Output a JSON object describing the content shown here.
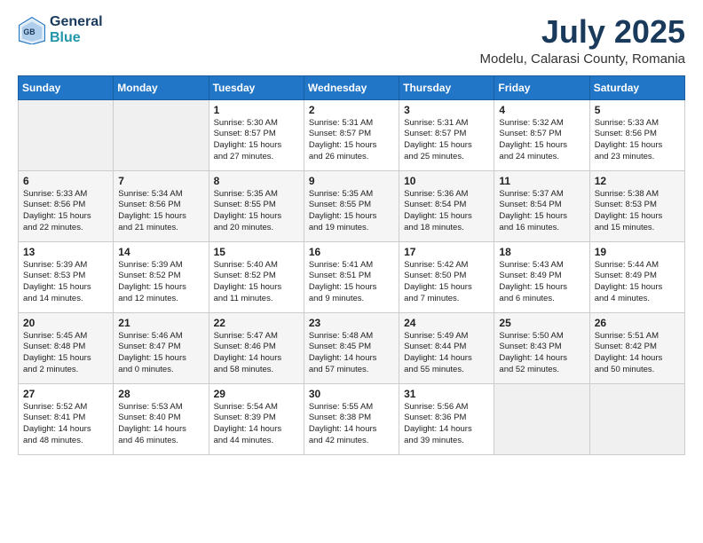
{
  "header": {
    "logo_line1": "General",
    "logo_line2": "Blue",
    "month": "July 2025",
    "location": "Modelu, Calarasi County, Romania"
  },
  "days_of_week": [
    "Sunday",
    "Monday",
    "Tuesday",
    "Wednesday",
    "Thursday",
    "Friday",
    "Saturday"
  ],
  "weeks": [
    [
      {
        "day": "",
        "info": ""
      },
      {
        "day": "",
        "info": ""
      },
      {
        "day": "1",
        "info": "Sunrise: 5:30 AM\nSunset: 8:57 PM\nDaylight: 15 hours\nand 27 minutes."
      },
      {
        "day": "2",
        "info": "Sunrise: 5:31 AM\nSunset: 8:57 PM\nDaylight: 15 hours\nand 26 minutes."
      },
      {
        "day": "3",
        "info": "Sunrise: 5:31 AM\nSunset: 8:57 PM\nDaylight: 15 hours\nand 25 minutes."
      },
      {
        "day": "4",
        "info": "Sunrise: 5:32 AM\nSunset: 8:57 PM\nDaylight: 15 hours\nand 24 minutes."
      },
      {
        "day": "5",
        "info": "Sunrise: 5:33 AM\nSunset: 8:56 PM\nDaylight: 15 hours\nand 23 minutes."
      }
    ],
    [
      {
        "day": "6",
        "info": "Sunrise: 5:33 AM\nSunset: 8:56 PM\nDaylight: 15 hours\nand 22 minutes."
      },
      {
        "day": "7",
        "info": "Sunrise: 5:34 AM\nSunset: 8:56 PM\nDaylight: 15 hours\nand 21 minutes."
      },
      {
        "day": "8",
        "info": "Sunrise: 5:35 AM\nSunset: 8:55 PM\nDaylight: 15 hours\nand 20 minutes."
      },
      {
        "day": "9",
        "info": "Sunrise: 5:35 AM\nSunset: 8:55 PM\nDaylight: 15 hours\nand 19 minutes."
      },
      {
        "day": "10",
        "info": "Sunrise: 5:36 AM\nSunset: 8:54 PM\nDaylight: 15 hours\nand 18 minutes."
      },
      {
        "day": "11",
        "info": "Sunrise: 5:37 AM\nSunset: 8:54 PM\nDaylight: 15 hours\nand 16 minutes."
      },
      {
        "day": "12",
        "info": "Sunrise: 5:38 AM\nSunset: 8:53 PM\nDaylight: 15 hours\nand 15 minutes."
      }
    ],
    [
      {
        "day": "13",
        "info": "Sunrise: 5:39 AM\nSunset: 8:53 PM\nDaylight: 15 hours\nand 14 minutes."
      },
      {
        "day": "14",
        "info": "Sunrise: 5:39 AM\nSunset: 8:52 PM\nDaylight: 15 hours\nand 12 minutes."
      },
      {
        "day": "15",
        "info": "Sunrise: 5:40 AM\nSunset: 8:52 PM\nDaylight: 15 hours\nand 11 minutes."
      },
      {
        "day": "16",
        "info": "Sunrise: 5:41 AM\nSunset: 8:51 PM\nDaylight: 15 hours\nand 9 minutes."
      },
      {
        "day": "17",
        "info": "Sunrise: 5:42 AM\nSunset: 8:50 PM\nDaylight: 15 hours\nand 7 minutes."
      },
      {
        "day": "18",
        "info": "Sunrise: 5:43 AM\nSunset: 8:49 PM\nDaylight: 15 hours\nand 6 minutes."
      },
      {
        "day": "19",
        "info": "Sunrise: 5:44 AM\nSunset: 8:49 PM\nDaylight: 15 hours\nand 4 minutes."
      }
    ],
    [
      {
        "day": "20",
        "info": "Sunrise: 5:45 AM\nSunset: 8:48 PM\nDaylight: 15 hours\nand 2 minutes."
      },
      {
        "day": "21",
        "info": "Sunrise: 5:46 AM\nSunset: 8:47 PM\nDaylight: 15 hours\nand 0 minutes."
      },
      {
        "day": "22",
        "info": "Sunrise: 5:47 AM\nSunset: 8:46 PM\nDaylight: 14 hours\nand 58 minutes."
      },
      {
        "day": "23",
        "info": "Sunrise: 5:48 AM\nSunset: 8:45 PM\nDaylight: 14 hours\nand 57 minutes."
      },
      {
        "day": "24",
        "info": "Sunrise: 5:49 AM\nSunset: 8:44 PM\nDaylight: 14 hours\nand 55 minutes."
      },
      {
        "day": "25",
        "info": "Sunrise: 5:50 AM\nSunset: 8:43 PM\nDaylight: 14 hours\nand 52 minutes."
      },
      {
        "day": "26",
        "info": "Sunrise: 5:51 AM\nSunset: 8:42 PM\nDaylight: 14 hours\nand 50 minutes."
      }
    ],
    [
      {
        "day": "27",
        "info": "Sunrise: 5:52 AM\nSunset: 8:41 PM\nDaylight: 14 hours\nand 48 minutes."
      },
      {
        "day": "28",
        "info": "Sunrise: 5:53 AM\nSunset: 8:40 PM\nDaylight: 14 hours\nand 46 minutes."
      },
      {
        "day": "29",
        "info": "Sunrise: 5:54 AM\nSunset: 8:39 PM\nDaylight: 14 hours\nand 44 minutes."
      },
      {
        "day": "30",
        "info": "Sunrise: 5:55 AM\nSunset: 8:38 PM\nDaylight: 14 hours\nand 42 minutes."
      },
      {
        "day": "31",
        "info": "Sunrise: 5:56 AM\nSunset: 8:36 PM\nDaylight: 14 hours\nand 39 minutes."
      },
      {
        "day": "",
        "info": ""
      },
      {
        "day": "",
        "info": ""
      }
    ]
  ]
}
